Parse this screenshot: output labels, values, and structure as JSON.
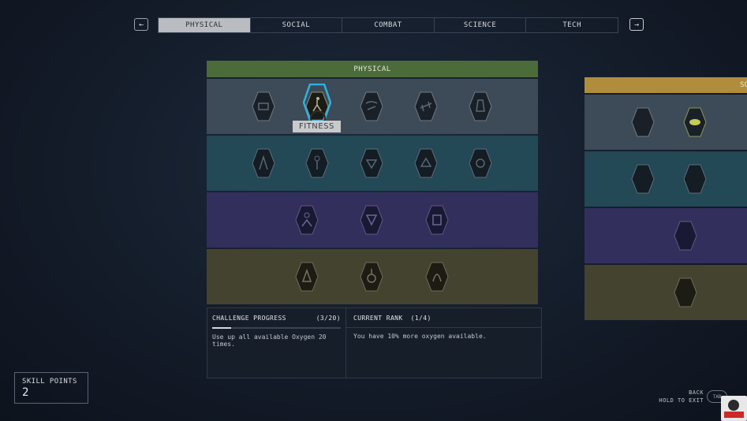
{
  "nav": {
    "prev_icon": "arrow-left-icon",
    "next_icon": "arrow-right-icon"
  },
  "tabs": [
    {
      "label": "PHYSICAL",
      "active": true
    },
    {
      "label": "SOCIAL",
      "active": false
    },
    {
      "label": "COMBAT",
      "active": false
    },
    {
      "label": "SCIENCE",
      "active": false
    },
    {
      "label": "TECH",
      "active": false
    }
  ],
  "physical_panel": {
    "title": "PHYSICAL",
    "selected_skill": "FITNESS",
    "rows": [
      {
        "tier": 1,
        "color": "#3c4b57",
        "skills": [
          "boxing-icon",
          "fitness-icon",
          "stealth-icon",
          "weight-lifting-icon",
          "wellness-icon"
        ]
      },
      {
        "tier": 2,
        "color": "#234856",
        "skills": [
          "energy-weapon-dissipation-icon",
          "environmental-conditioning-icon",
          "gymnastics-icon",
          "nutrition-icon",
          "pain-tolerance-icon"
        ]
      },
      {
        "tier": 3,
        "color": "#332f5c",
        "skills": [
          "cellular-regeneration-icon",
          "decontamination-icon",
          "martial-arts-icon"
        ]
      },
      {
        "tier": 4,
        "color": "#444330",
        "skills": [
          "concealment-icon",
          "rejuvenation-icon",
          "xenomorphic-icon"
        ]
      }
    ]
  },
  "challenge": {
    "label": "CHALLENGE PROGRESS",
    "count": "(3/20)",
    "progress": 0.15,
    "description": "Use up all available Oxygen 20 times."
  },
  "rank": {
    "label": "CURRENT RANK",
    "value": "(1/4)",
    "description": "You have 10% more oxygen available."
  },
  "social_panel": {
    "title": "SO",
    "color": "#b08d3c"
  },
  "skill_points": {
    "label": "SKILL POINTS",
    "value": "2"
  },
  "footer": {
    "back": "BACK",
    "hold": "HOLD TO EXIT",
    "key": "TAB"
  }
}
